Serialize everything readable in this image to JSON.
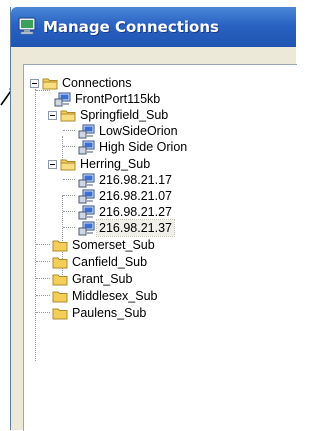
{
  "window": {
    "title": "Manage Connections"
  },
  "tree": {
    "root": "Connections",
    "items": [
      "FrontPort115kb",
      "Springfield_Sub",
      "LowSideOrion",
      "High Side Orion",
      "Herring_Sub",
      "216.98.21.17",
      "216.98.21.07",
      "216.98.21.27",
      "216.98.21.37",
      "Somerset_Sub",
      "Canfield_Sub",
      "Grant_Sub",
      "Middlesex_Sub",
      "Paulens_Sub"
    ],
    "selected": "216.98.21.37"
  },
  "icons": {
    "app": "computer-monitor-icon",
    "folder": "folder-icon",
    "connection": "network-computer-icon",
    "expander": "minus-box-icon"
  },
  "colors": {
    "titlebar": "#2a63c2",
    "folder": "#f3cf5a",
    "connection_screen": "#3b6fd1"
  }
}
